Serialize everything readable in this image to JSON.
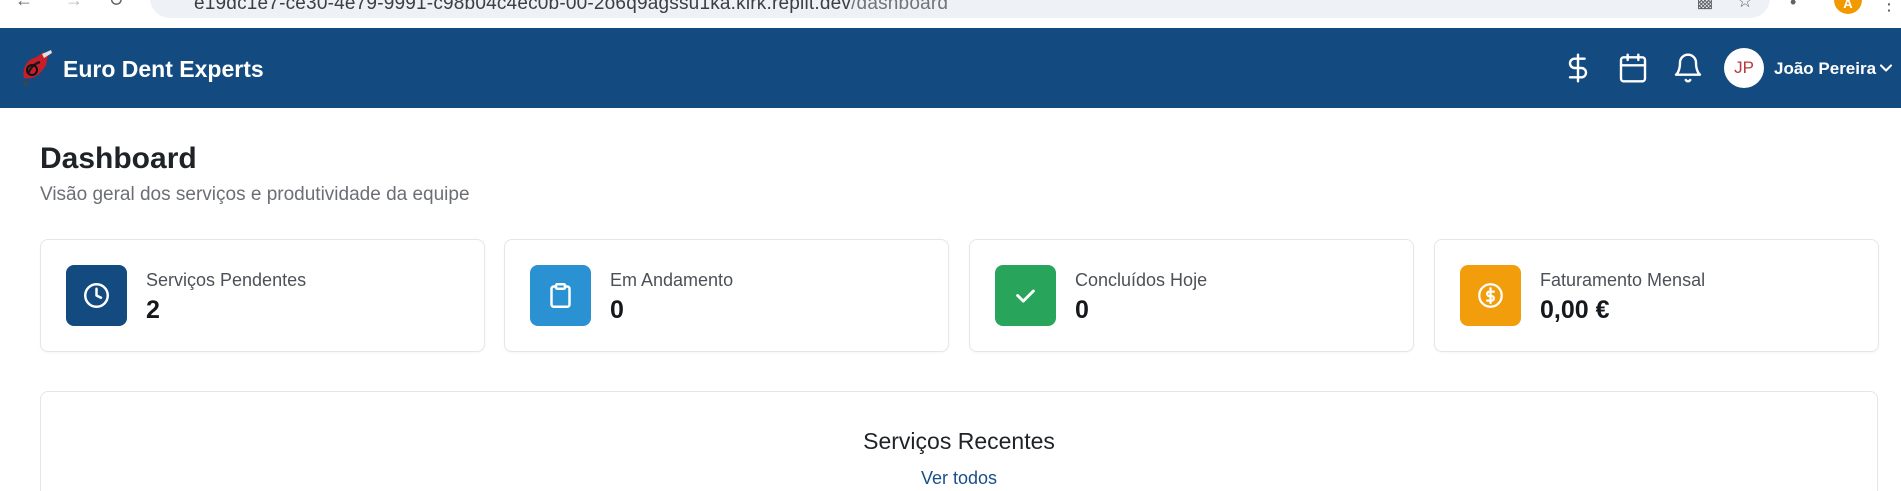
{
  "browser": {
    "url_main": "e19dc1e7-ce30-4e79-9991-c98b04c4ec0b-00-2o6q9agssu1ka.kirk.replit.dev",
    "url_path": "/dashboard"
  },
  "header": {
    "brand": "Euro Dent Experts",
    "icons": [
      "dollar-icon",
      "calendar-icon",
      "bell-icon"
    ],
    "user_initials": "JP",
    "user_name": "João Pereira",
    "bg_color": "#134a7f"
  },
  "page": {
    "title": "Dashboard",
    "subtitle": "Visão geral dos serviços e produtividade da equipe"
  },
  "stats": [
    {
      "label": "Serviços Pendentes",
      "value": "2",
      "icon": "clock-icon",
      "color": "#134a7f"
    },
    {
      "label": "Em Andamento",
      "value": "0",
      "icon": "clipboard-icon",
      "color": "#2a92d2"
    },
    {
      "label": "Concluídos Hoje",
      "value": "0",
      "icon": "check-icon",
      "color": "#28a55a"
    },
    {
      "label": "Faturamento Mensal",
      "value": "0,00 €",
      "icon": "dollar-circle-icon",
      "color": "#f29e0c"
    }
  ],
  "recent": {
    "title": "Serviços Recentes",
    "link": "Ver todos"
  }
}
